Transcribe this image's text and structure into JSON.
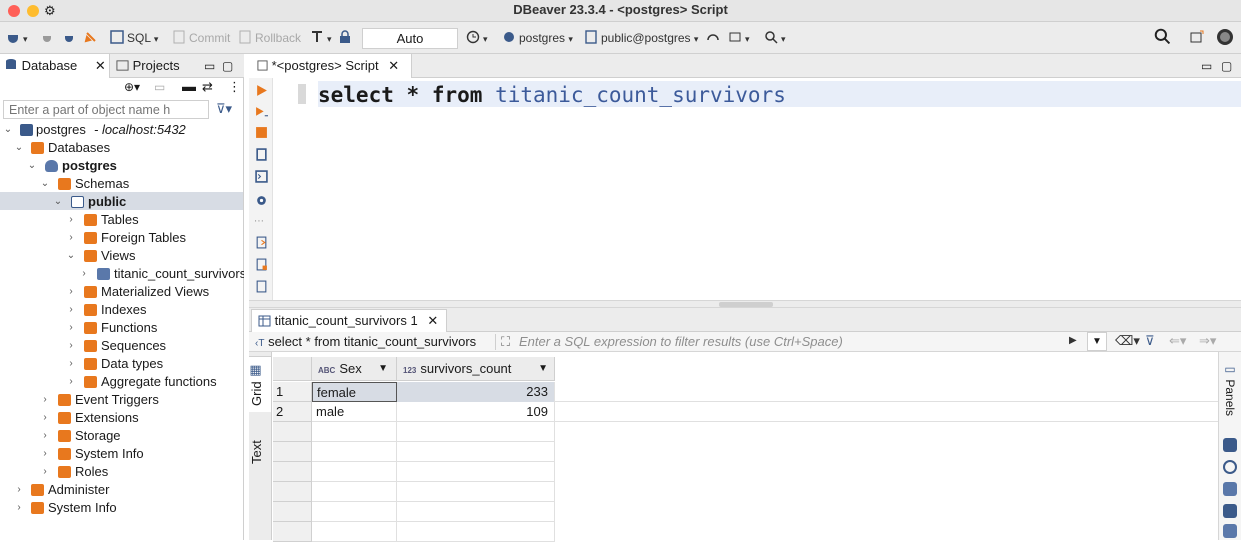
{
  "window": {
    "title": "DBeaver 23.3.4 - <postgres> Script"
  },
  "toolbar": {
    "sql_label": "SQL",
    "commit_label": "Commit",
    "rollback_label": "Rollback",
    "transaction_mode": "Auto",
    "datasource": "postgres",
    "schema": "public@postgres"
  },
  "navigator": {
    "tab_database": "Database",
    "tab_projects": "Projects",
    "filter_placeholder": "Enter a part of object name h",
    "tree": [
      {
        "label": "postgres",
        "suffix": " - localhost:5432"
      },
      {
        "label": "Databases"
      },
      {
        "label": "postgres"
      },
      {
        "label": "Schemas"
      },
      {
        "label": "public"
      },
      {
        "label": "Tables"
      },
      {
        "label": "Foreign Tables"
      },
      {
        "label": "Views"
      },
      {
        "label": "titanic_count_survivors"
      },
      {
        "label": "Materialized Views"
      },
      {
        "label": "Indexes"
      },
      {
        "label": "Functions"
      },
      {
        "label": "Sequences"
      },
      {
        "label": "Data types"
      },
      {
        "label": "Aggregate functions"
      },
      {
        "label": "Event Triggers"
      },
      {
        "label": "Extensions"
      },
      {
        "label": "Storage"
      },
      {
        "label": "System Info"
      },
      {
        "label": "Roles"
      },
      {
        "label": "Administer"
      },
      {
        "label": "System Info"
      }
    ]
  },
  "editor": {
    "tab_title": "*<postgres> Script",
    "sql_select": "select",
    "sql_star": "*",
    "sql_from": "from",
    "sql_table": "titanic_count_survivors"
  },
  "results": {
    "tab_title": "titanic_count_survivors 1",
    "query_text": "select * from titanic_count_survivors",
    "filter_placeholder": "Enter a SQL expression to filter results (use Ctrl+Space)",
    "vtab_grid": "Grid",
    "vtab_text": "Text",
    "panels_label": "Panels",
    "columns": [
      {
        "name": "Sex",
        "type": "ABC"
      },
      {
        "name": "survivors_count",
        "type": "123"
      }
    ],
    "rows": [
      {
        "num": "1",
        "sex": "female",
        "count": "233"
      },
      {
        "num": "2",
        "sex": "male",
        "count": "109"
      }
    ]
  },
  "colors": {
    "accent_orange": "#e8781e",
    "selection": "#d7dce4",
    "identifier": "#3c5a9a"
  }
}
